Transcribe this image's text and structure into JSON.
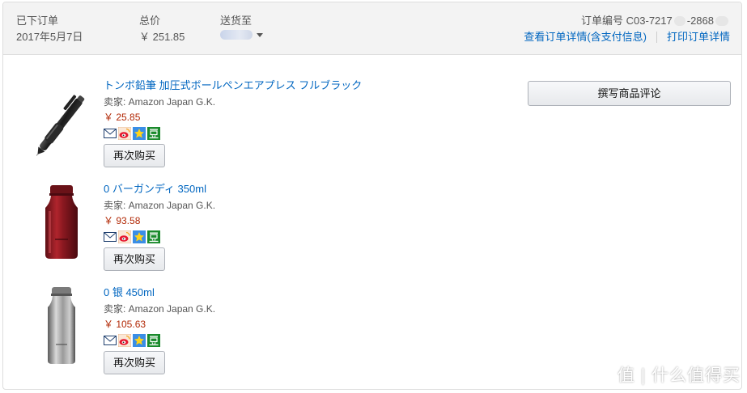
{
  "order": {
    "placed_label": "已下订单",
    "placed_date": "2017年5月7日",
    "total_label": "总价",
    "total_value": "￥ 251.85",
    "ship_to_label": "送货至",
    "order_number_prefix": "订单编号 C03-7217",
    "order_number_middle": "-2868",
    "details_link": "查看订单详情(含支付信息)",
    "print_link": "打印订单详情",
    "review_button": "撰写商品评论"
  },
  "items": [
    {
      "title": "トンボ鉛筆 加圧式ボールペンエアプレス フルブラック",
      "seller": "卖家: Amazon Japan G.K.",
      "price": "￥ 25.85",
      "buy_again": "再次购买"
    },
    {
      "title": "0 バーガンディ 350ml",
      "seller": "卖家: Amazon Japan G.K.",
      "price": "￥ 93.58",
      "buy_again": "再次购买"
    },
    {
      "title": "0 银 450ml",
      "seller": "卖家: Amazon Japan G.K.",
      "price": "￥ 105.63",
      "buy_again": "再次购买"
    }
  ],
  "share_icons": [
    "email-icon",
    "weibo-icon",
    "qzone-icon",
    "douban-icon"
  ],
  "watermark": {
    "text": "值 | 什么值得买",
    "icon": "smzdm-logo-icon"
  },
  "colors": {
    "link": "#0066c0",
    "price": "#b12704",
    "header_bg": "#f3f3f3",
    "border": "#dddddd"
  }
}
